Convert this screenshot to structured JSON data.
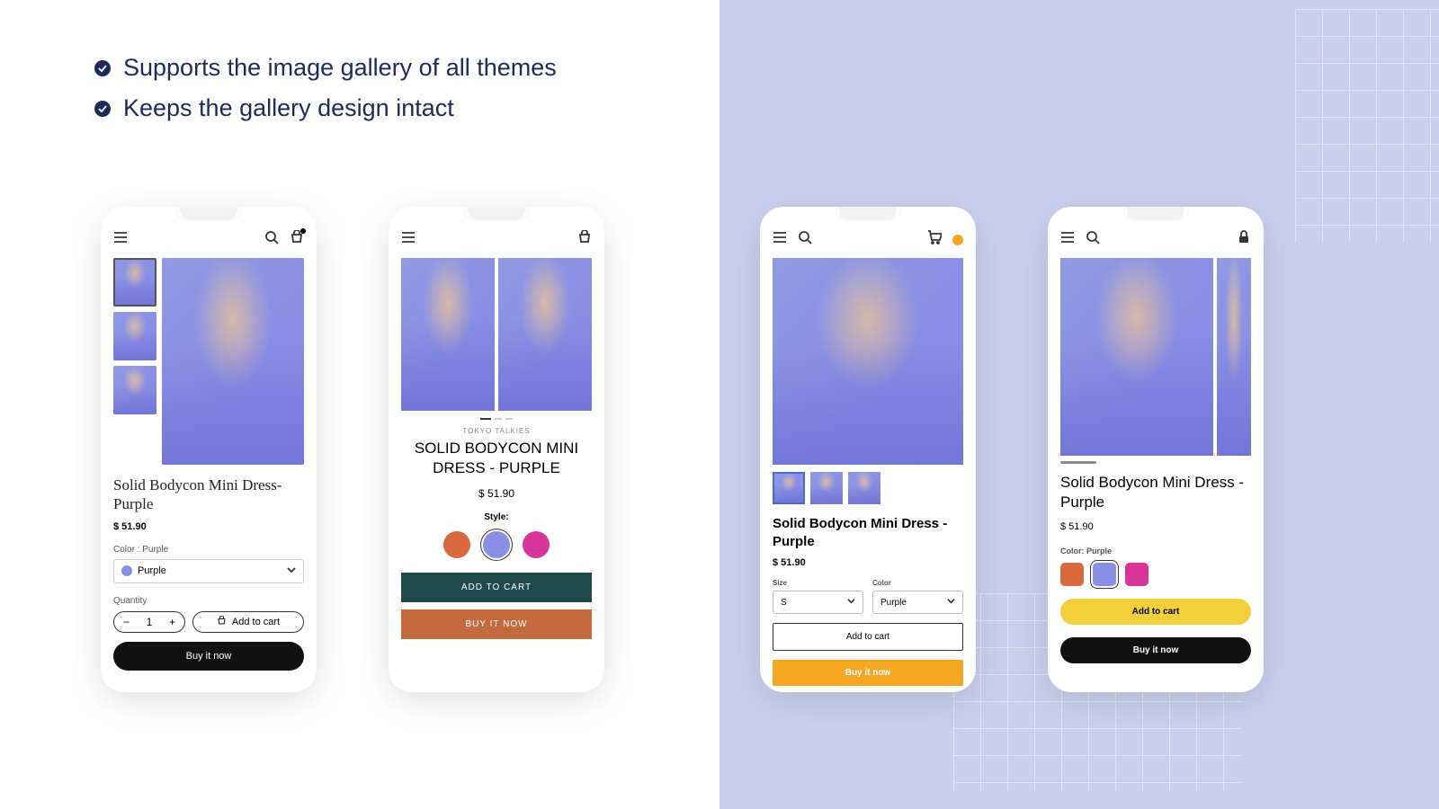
{
  "features": [
    "Supports the image gallery of all themes",
    "Keeps the gallery design intact"
  ],
  "phone1": {
    "title": "Solid Bodycon Mini Dress- Purple",
    "price": "$ 51.90",
    "color_label": "Color : Purple",
    "color_value": "Purple",
    "quantity_label": "Quantity",
    "quantity_value": "1",
    "add_to_cart": "Add to cart",
    "buy_now": "Buy it now"
  },
  "phone2": {
    "brand": "TOKYO TALKIES",
    "title": "SOLID BODYCON MINI DRESS - PURPLE",
    "price": "$ 51.90",
    "style_label": "Style:",
    "swatches": [
      "#d96a3f",
      "#8a8fe6",
      "#d8359b"
    ],
    "add_to_cart": "ADD TO CART",
    "buy_now": "BUY IT NOW"
  },
  "phone3": {
    "title": "Solid Bodycon Mini Dress - Purple",
    "price": "$ 51.90",
    "size_label": "Size",
    "size_value": "S",
    "color_label": "Color",
    "color_value": "Purple",
    "add_to_cart": "Add to cart",
    "buy_now": "Buy it now"
  },
  "phone4": {
    "title": "Solid Bodycon Mini Dress - Purple",
    "price": "$ 51.90",
    "color_label": "Color: Purple",
    "swatches": [
      "#d96a3f",
      "#8a8fe6",
      "#d8359b"
    ],
    "add_to_cart": "Add to cart",
    "buy_now": "Buy it now"
  }
}
